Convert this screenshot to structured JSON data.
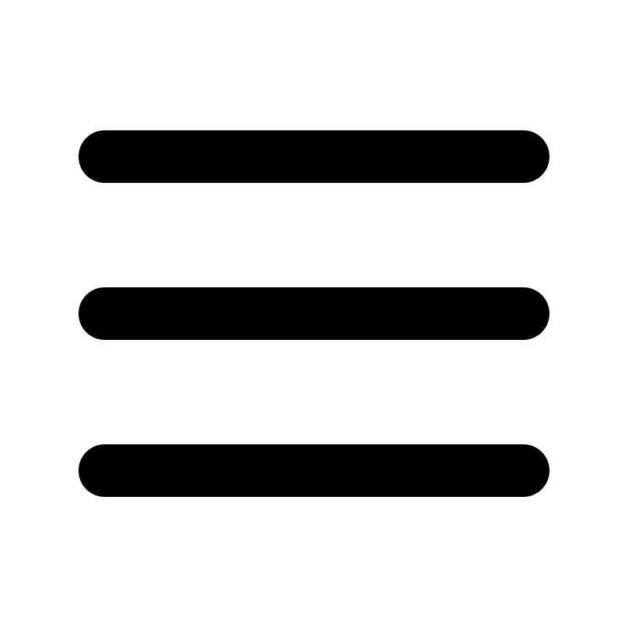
{
  "icon": {
    "name": "hamburger-menu-icon",
    "color": "#000000",
    "background": "#ffffff"
  }
}
